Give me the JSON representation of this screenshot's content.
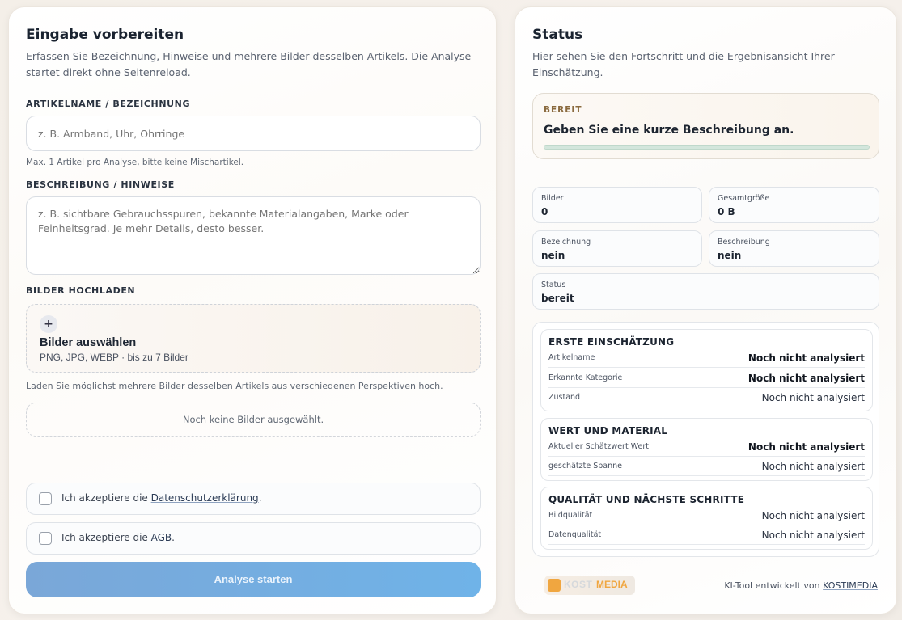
{
  "left": {
    "title": "Eingabe vorbereiten",
    "intro": "Erfassen Sie Bezeichnung, Hinweise und mehrere Bilder desselben Artikels. Die Analyse startet direkt ohne Seitenreload.",
    "name_label": "ARTIKELNAME / BEZEICHNUNG",
    "name_placeholder": "z. B. Armband, Uhr, Ohrringe",
    "name_help": "Max. 1 Artikel pro Analyse, bitte keine Mischartikel.",
    "desc_label": "BESCHREIBUNG / HINWEISE",
    "desc_placeholder": "z. B. sichtbare Gebrauchsspuren, bekannte Materialangaben, Marke oder Feinheitsgrad. Je mehr Details, desto besser.",
    "upload_label": "BILDER HOCHLADEN",
    "upload_plus": "+",
    "upload_title": "Bilder auswählen",
    "upload_sub": "PNG, JPG, WEBP · bis zu 7 Bilder",
    "upload_help": "Laden Sie möglichst mehrere Bilder desselben Artikels aus verschiedenen Perspektiven hoch.",
    "empty_text": "Noch keine Bilder ausgewählt.",
    "privacy_prefix": "Ich akzeptiere die ",
    "privacy_link": "Datenschutzerklärung",
    "privacy_suffix": ".",
    "terms_prefix": "Ich akzeptiere die ",
    "terms_link": "AGB",
    "terms_suffix": ".",
    "submit_label": "Analyse starten"
  },
  "right": {
    "title": "Status",
    "intro": "Hier sehen Sie den Fortschritt und die Ergebnisansicht Ihrer Einschätzung.",
    "status_chip": "BEREIT",
    "status_message": "Geben Sie eine kurze Beschreibung an.",
    "progress": 0,
    "stats": {
      "images_label": "Bilder",
      "images_value": "0",
      "size_label": "Gesamtgröße",
      "size_value": "0 B",
      "name_label": "Bezeichnung",
      "name_value": "nein",
      "desc_label": "Beschreibung",
      "desc_value": "nein",
      "status_label": "Status",
      "status_value": "bereit"
    },
    "groups": [
      {
        "title": "ERSTE EINSCHÄTZUNG",
        "rows": [
          {
            "label": "Artikelname",
            "value": "Noch nicht analysiert",
            "bold": true
          },
          {
            "label": "Erkannte Kategorie",
            "value": "Noch nicht analysiert",
            "bold": true
          },
          {
            "label": "Zustand",
            "value": "Noch nicht analysiert",
            "bold": false
          }
        ]
      },
      {
        "title": "WERT UND MATERIAL",
        "rows": [
          {
            "label": "Aktueller Schätzwert Wert",
            "value": "Noch nicht analysiert",
            "bold": true
          },
          {
            "label": "geschätzte Spanne",
            "value": "Noch nicht analysiert",
            "bold": false
          }
        ]
      },
      {
        "title": "QUALITÄT UND NÄCHSTE SCHRITTE",
        "rows": [
          {
            "label": "Bildqualität",
            "value": "Noch nicht analysiert",
            "bold": false
          },
          {
            "label": "Datenqualität",
            "value": "Noch nicht analysiert",
            "bold": false
          }
        ]
      }
    ],
    "logo_kost": "KOST",
    "logo_media": "MEDIA",
    "credit_prefix": "KI-Tool entwickelt von ",
    "credit_link": "KOSTIMEDIA"
  },
  "colors": {
    "accent_button": "#6fb3e8",
    "status_chip": "#8a6a3e",
    "progress_track": "#d3e6dc",
    "logo_orange": "#f0a640"
  }
}
